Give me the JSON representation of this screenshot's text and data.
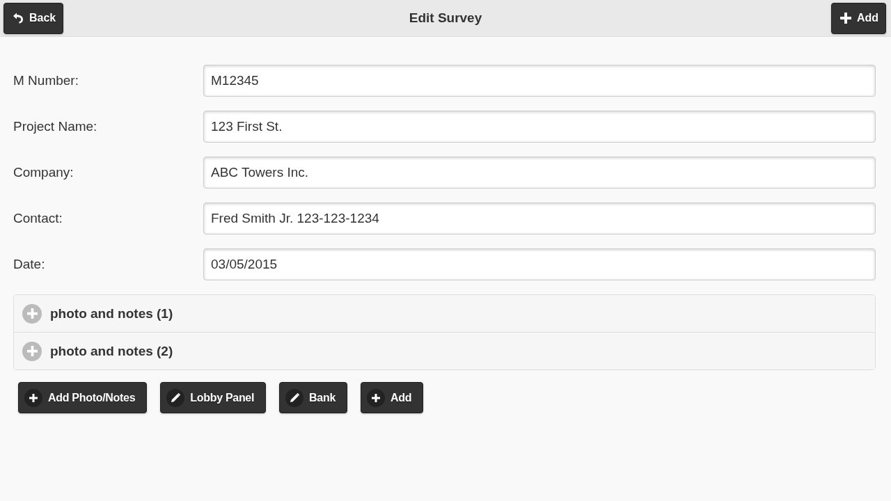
{
  "header": {
    "back_button": {
      "label": "Back"
    },
    "title": "Edit Survey",
    "add_button": {
      "label": "Add"
    }
  },
  "fields": [
    {
      "label": "M Number:",
      "value": "M12345"
    },
    {
      "label": "Project Name:",
      "value": "123 First St."
    },
    {
      "label": "Company:",
      "value": "ABC Towers Inc."
    },
    {
      "label": "Contact:",
      "value": "Fred Smith Jr. 123-123-1234"
    },
    {
      "label": "Date:",
      "value": "03/05/2015"
    }
  ],
  "collapsibles": [
    {
      "title": "photo and notes (1)",
      "expanded": false
    },
    {
      "title": "photo and notes (2)",
      "expanded": false
    }
  ],
  "buttons": [
    {
      "label": "Add Photo/Notes",
      "kind": "plus"
    },
    {
      "label": "Lobby Panel",
      "kind": "edit"
    },
    {
      "label": "Bank",
      "kind": "edit"
    },
    {
      "label": "Add",
      "kind": "plus"
    }
  ]
}
